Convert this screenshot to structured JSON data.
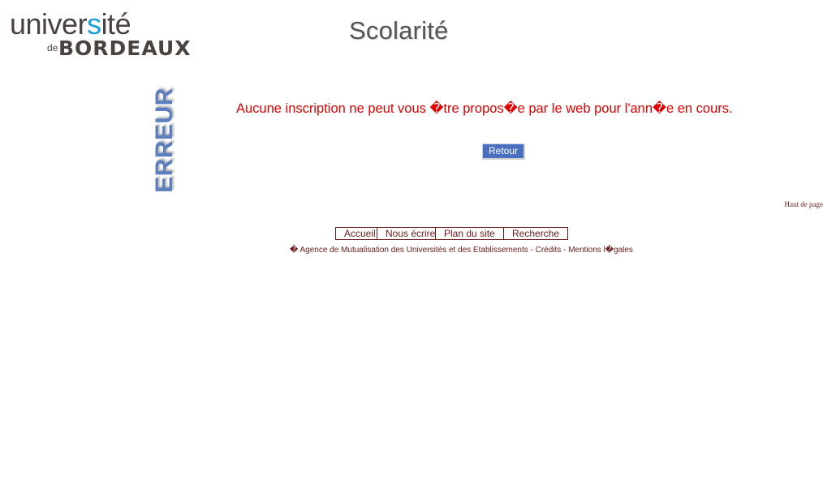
{
  "header": {
    "logo_line1_a": "univer",
    "logo_line1_b": "s",
    "logo_line1_c": "ité",
    "logo_de": "de",
    "logo_line2": "BORDEAUX",
    "title": "Scolarité"
  },
  "sidebar": {
    "vertical_label": "ERREUR"
  },
  "main": {
    "error_message": "Aucune inscription ne peut vous �tre propos�e par le web pour l'ann�e en cours.",
    "back_button_label": "Retour",
    "top_link_label": "Haut de page"
  },
  "footer": {
    "nav": [
      {
        "label": "Accueil"
      },
      {
        "label": "Nous écrire"
      },
      {
        "label": "Plan du site"
      },
      {
        "label": "Recherche"
      }
    ],
    "copyright": "� Agence de Mutualisation des Universités et des Etablissements - Crédits - Mentions l�gales"
  },
  "colors": {
    "error_red": "#e00000",
    "button_blue": "#4a6fc1",
    "label_blue": "#5e7fbe",
    "link_maroon": "#6b1a1a",
    "logo_cyan": "#1aa0d8"
  }
}
